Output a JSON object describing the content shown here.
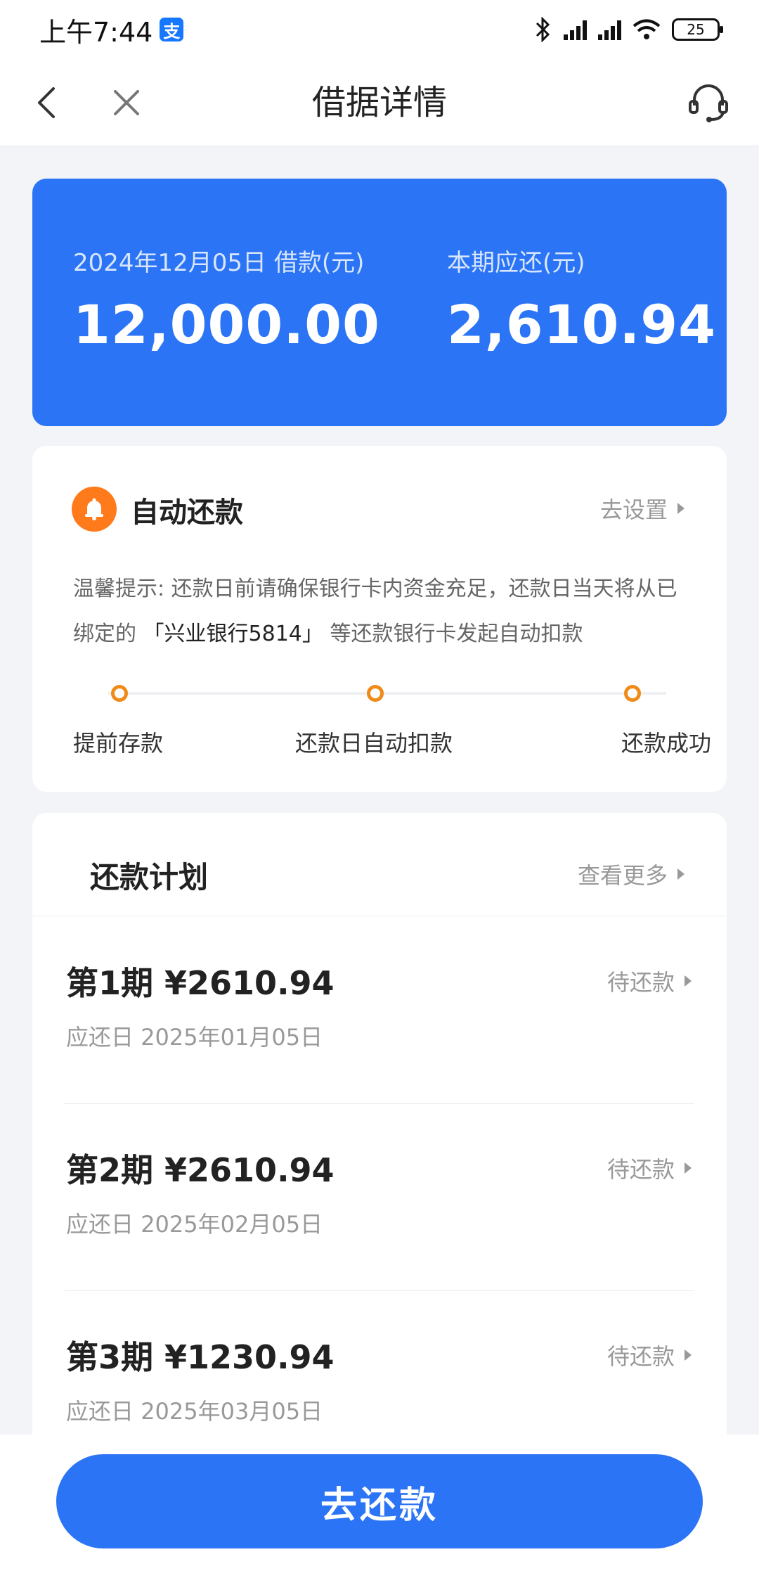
{
  "status_bar": {
    "time": "上午7:44",
    "app_badge": "支",
    "battery": "25"
  },
  "nav": {
    "title": "借据详情",
    "icons": [
      "back-icon",
      "close-icon",
      "customer-service-icon"
    ]
  },
  "loan_summary": {
    "loan_label": "2024年12月05日 借款(元)",
    "loan_amount": "12,000.00",
    "due_label": "本期应还(元)",
    "due_amount": "2,610.94",
    "color": "#2b74f5"
  },
  "auto_repay": {
    "title": "自动还款",
    "settings_link": "去设置",
    "tip_prefix": "温馨提示: 还款日前请确保银行卡内资金充足，还款日当天将从已绑定的",
    "tip_bank": "「兴业银行5814」",
    "tip_suffix": "等还款银行卡发起自动扣款",
    "steps": [
      "提前存款",
      "还款日自动扣款",
      "还款成功"
    ],
    "accent": "#f08a18"
  },
  "plan": {
    "title": "还款计划",
    "more_link": "查看更多",
    "rows": [
      {
        "period": "第1期",
        "amount": "¥2610.94",
        "date_label": "应还日",
        "date": "2025年01月05日",
        "status": "待还款"
      },
      {
        "period": "第2期",
        "amount": "¥2610.94",
        "date_label": "应还日",
        "date": "2025年02月05日",
        "status": "待还款"
      },
      {
        "period": "第3期",
        "amount": "¥1230.94",
        "date_label": "应还日",
        "date": "2025年03月05日",
        "status": "待还款"
      }
    ]
  },
  "footer": {
    "pay_label": "去还款"
  }
}
